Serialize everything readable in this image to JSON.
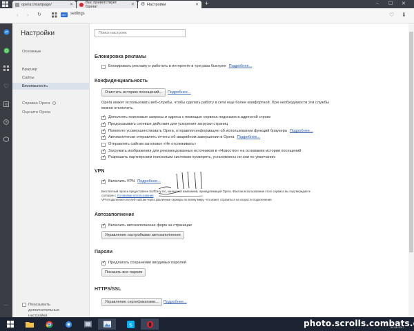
{
  "tabs": [
    {
      "title": "opera://startpage/",
      "active": false
    },
    {
      "title": "Вас приветствует Opera!",
      "active": false
    },
    {
      "title": "Настройки",
      "active": true
    }
  ],
  "address": {
    "badge": "SET",
    "url": "settings"
  },
  "nav": {
    "title": "Настройки",
    "items": [
      "Основные",
      "Браузер",
      "Сайты",
      "Безопасность"
    ],
    "active_index": 3,
    "extra": [
      "Справка Opera",
      "Оцените Opera"
    ],
    "advanced_label": "Показывать дополнительные настройки"
  },
  "search": {
    "placeholder": "Поиск настроек"
  },
  "adblock": {
    "title": "Блокировка рекламы",
    "checkbox": "Блокировать рекламу и работать в интернете в три раза быстрее",
    "more": "Подробнее..."
  },
  "privacy": {
    "title": "Конфиденциальность",
    "clear_button": "Очистить историю посещений...",
    "more": "Подробнее...",
    "description": "Opera может использовать веб-службы, чтобы сделать работу в сети еще более комфортной. При необходимости эти службы можно отключить.",
    "options": [
      {
        "label": "Дополнять поисковые запросы и адреса с помощью сервиса подсказок в адресной строке",
        "checked": true
      },
      {
        "label": "Предсказывать сетевые действия для ускорения загрузки страниц",
        "checked": true
      },
      {
        "label": "Помогите усовершенствовать Opera, отправляя информацию об использовании функций браузера",
        "checked": true,
        "more": "Подробнее..."
      },
      {
        "label": "Автоматически отправлять отчеты об аварийном завершении в Opera",
        "checked": true,
        "more": "Подробнее..."
      },
      {
        "label": "Отправлять сайтам заголовок «Не отслеживать»",
        "checked": false
      },
      {
        "label": "Загружать изображения для рекомендованных источников в «Новостях» на основании истории посещений",
        "checked": true
      },
      {
        "label": "Разрешить партнерским поисковым системам проверять, установлены ли они по умолчанию",
        "checked": true
      }
    ]
  },
  "vpn": {
    "title": "VPN",
    "checkbox": "Включить VPN",
    "more": "Подробнее...",
    "fine_print_1": "Бесплатный прокси предоставлен SurfEasy Inc, канадской компанией, принадлежащей Opera. Фактом использования этого сервиса вы подтверждаете согласие с",
    "terms_link": "Условиями использования",
    "fine_print_2": "VPN подключается к веб-сайтам через различные серверы по всему миру, что может отразиться на скорости подключения."
  },
  "autofill": {
    "title": "Автозаполнение",
    "checkbox": "Включить автозаполнение форм на страницах",
    "button": "Управление настройками автозаполнения"
  },
  "passwords": {
    "title": "Пароли",
    "checkbox": "Предлагать сохранение вводимых паролей",
    "button": "Показать все пароли"
  },
  "https": {
    "title": "HTTPS/SSL",
    "button": "Управление сертификатами...",
    "more": "Подробнее..."
  },
  "taskbar": {
    "watermark": "photo.scrolls.combats.com",
    "clock": "04.06.2017"
  },
  "colors": {
    "opera_red": "#e0222c",
    "link": "#2a5db0",
    "taskbar": "#1c2332"
  }
}
